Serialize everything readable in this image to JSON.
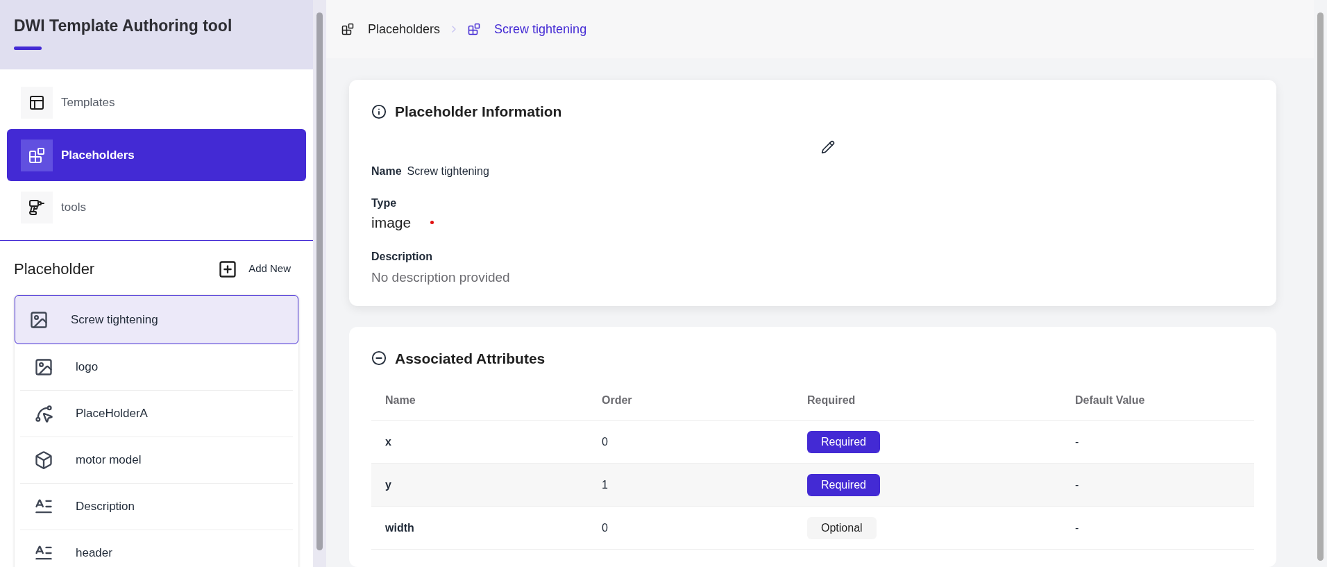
{
  "app": {
    "title": "DWI Template Authoring tool"
  },
  "nav": [
    {
      "label": "Templates",
      "kind": "templates",
      "selected": false
    },
    {
      "label": "Placeholders",
      "kind": "placeholders",
      "selected": true
    },
    {
      "label": "tools",
      "kind": "tools",
      "selected": false
    }
  ],
  "placeholder_list": {
    "title": "Placeholder",
    "add_button": "Add New",
    "items": [
      {
        "label": "Screw tightening",
        "kind": "image",
        "selected": true
      },
      {
        "label": "logo",
        "kind": "image",
        "selected": false
      },
      {
        "label": "PlaceHolderA",
        "kind": "curve",
        "selected": false
      },
      {
        "label": "motor model",
        "kind": "model",
        "selected": false
      },
      {
        "label": "Description",
        "kind": "text",
        "selected": false
      },
      {
        "label": "header",
        "kind": "text",
        "selected": false
      }
    ]
  },
  "breadcrumb": [
    {
      "label": "Placeholders",
      "current": false
    },
    {
      "label": "Screw tightening",
      "current": true
    }
  ],
  "info_card": {
    "title": "Placeholder Information",
    "fields": [
      {
        "label": "Name",
        "value": "Screw tightening",
        "kind": "inline"
      },
      {
        "label": "Type",
        "value": "image",
        "kind": "large",
        "required_marker": true
      },
      {
        "label": "Description",
        "value": "No description provided",
        "kind": "muted"
      }
    ]
  },
  "attributes": {
    "title": "Associated Attributes",
    "columns": [
      "Name",
      "Order",
      "Required",
      "Default Value"
    ],
    "rows": [
      {
        "name": "x",
        "order": "0",
        "required": {
          "label": "Required",
          "on": true
        },
        "default": "-"
      },
      {
        "name": "y",
        "order": "1",
        "required": {
          "label": "Required",
          "on": true
        },
        "default": "-"
      },
      {
        "name": "width",
        "order": "0",
        "required": {
          "label": "Optional",
          "on": false
        },
        "default": "-"
      }
    ]
  }
}
